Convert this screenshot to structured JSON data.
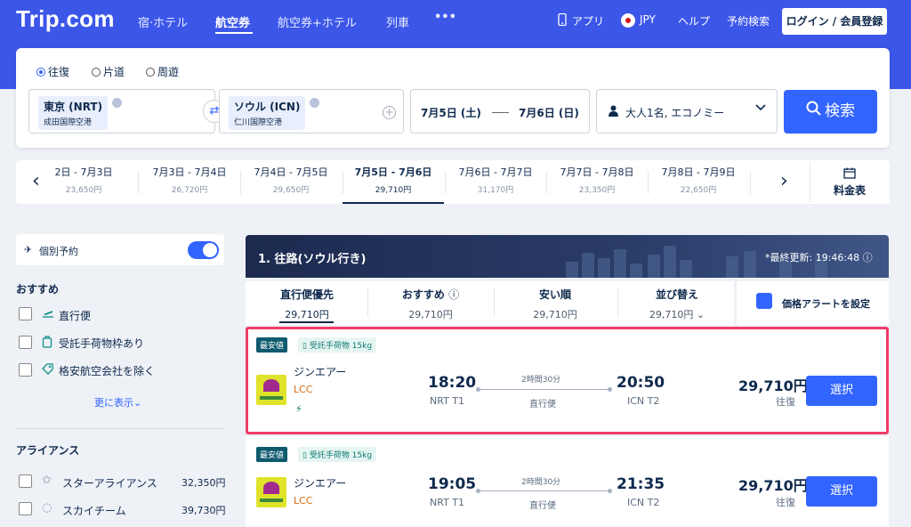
{
  "header": {
    "logo": "Trip.com",
    "nav": [
      "宿·ホテル",
      "航空券",
      "航空券+ホテル",
      "列車"
    ],
    "more": "•••",
    "app": "アプリ",
    "currency": "JPY",
    "help": "ヘルプ",
    "booking": "予約検索",
    "login": "ログイン / 会員登録",
    "flag_color": "#d7191c"
  },
  "search": {
    "trip_types": [
      "往復",
      "片道",
      "周遊"
    ],
    "selected_trip_type": "往復",
    "origin": {
      "city": "東京 (NRT)",
      "airport": "成田国際空港"
    },
    "destination": {
      "city": "ソウル (ICN)",
      "airport": "仁川国際空港"
    },
    "depart": "7月5日 (土)",
    "return": "7月6日 (日)",
    "passengers": "大人1名, エコノミー",
    "button": "検索"
  },
  "date_strip": {
    "items": [
      {
        "dates": "2日 - 7月3日",
        "price": "23,650円"
      },
      {
        "dates": "7月3日 - 7月4日",
        "price": "26,720円"
      },
      {
        "dates": "7月4日 - 7月5日",
        "price": "29,650円"
      },
      {
        "dates": "7月5日 - 7月6日",
        "price": "29,710円"
      },
      {
        "dates": "7月6日 - 7月7日",
        "price": "31,170円"
      },
      {
        "dates": "7月7日 - 7月8日",
        "price": "23,350円"
      },
      {
        "dates": "7月8日 - 7月9日",
        "price": "22,650円"
      }
    ],
    "selected_index": 3,
    "calendar_label": "料金表"
  },
  "filters": {
    "individual_booking": "個別予約",
    "recommended_title": "おすすめ",
    "recommended": [
      "直行便",
      "受託手荷物枠あり",
      "格安航空会社を除く"
    ],
    "show_more": "更に表示",
    "alliance_title": "アライアンス",
    "alliances": [
      {
        "name": "スターアライアンス",
        "price": "32,350円"
      },
      {
        "name": "スカイチーム",
        "price": "39,730円"
      }
    ]
  },
  "results": {
    "title": "1. 往路(ソウル行き)",
    "updated": "*最終更新: 19:46:48",
    "sort_tabs": [
      {
        "label": "直行便優先",
        "price": "29,710円"
      },
      {
        "label": "おすすめ",
        "price": "29,710円"
      },
      {
        "label": "安い順",
        "price": "29,710円"
      },
      {
        "label": "並び替え",
        "price": "29,710円"
      }
    ],
    "alert": "価格アラートを設定",
    "flights": [
      {
        "badge": "最安値",
        "baggage": "受託手荷物 15kg",
        "airline": "ジンエアー",
        "type": "LCC",
        "dep_time": "18:20",
        "dep_airport": "NRT T1",
        "duration": "2時間30分",
        "stops": "直行便",
        "arr_time": "20:50",
        "arr_airport": "ICN T2",
        "price": "29,710円",
        "price_note": "往復",
        "select": "選択"
      },
      {
        "badge": "最安値",
        "baggage": "受託手荷物 15kg",
        "airline": "ジンエアー",
        "type": "LCC",
        "dep_time": "19:05",
        "dep_airport": "NRT T1",
        "duration": "2時間30分",
        "stops": "直行便",
        "arr_time": "21:35",
        "arr_airport": "ICN T2",
        "price": "29,710円",
        "price_note": "往復",
        "select": "選択"
      }
    ]
  },
  "colors": {
    "brand_blue": "#3c56e8",
    "button_blue": "#3264ff",
    "highlight": "#f03c6a",
    "lcc": "#d66a12"
  }
}
